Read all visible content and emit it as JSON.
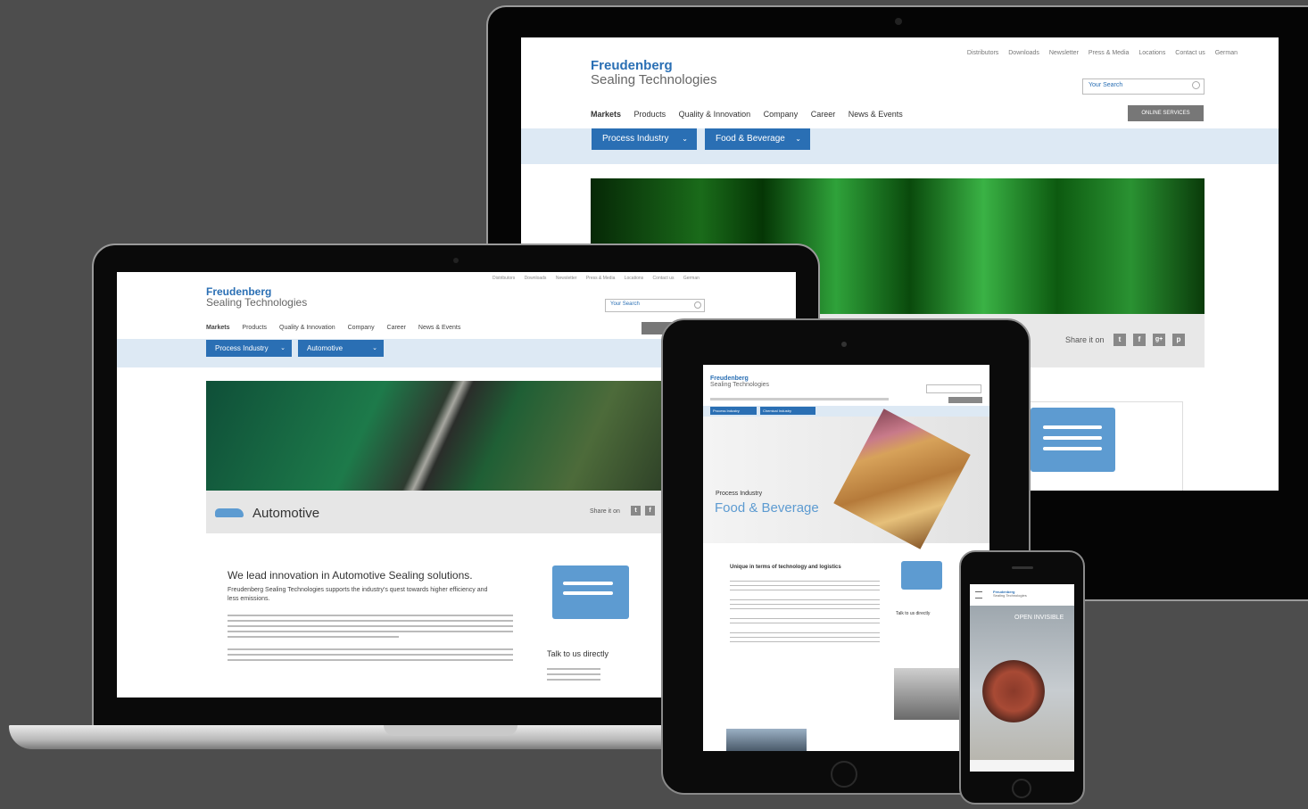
{
  "brand": {
    "name": "Freudenberg",
    "sub": "Sealing Technologies"
  },
  "top_nav": [
    "Distributors",
    "Downloads",
    "Newsletter",
    "Press & Media",
    "Locations",
    "Contact us",
    "German"
  ],
  "search_placeholder": "Your Search",
  "main_nav": [
    "Markets",
    "Products",
    "Quality & Innovation",
    "Company",
    "Career",
    "News & Events"
  ],
  "online_services": "ONLINE SERVICES",
  "share_label": "Share it on",
  "share_icons": [
    "t",
    "f",
    "g+",
    "p"
  ],
  "desktop": {
    "breadcrumb_buttons": [
      "Process Industry",
      "Food & Beverage"
    ]
  },
  "laptop": {
    "breadcrumb_buttons": [
      "Process Industry",
      "Automotive"
    ],
    "hero_title": "Automotive",
    "headline": "We lead innovation in Automotive Sealing solutions.",
    "subhead": "Freudenberg Sealing Technologies supports the industry's quest towards higher efficiency and less emissions.",
    "contact_cta": "Talk to us directly"
  },
  "tablet": {
    "breadcrumb_buttons": [
      "Process Industry",
      "Chemical Industry"
    ],
    "kicker": "Process Industry",
    "hero_title": "Food & Beverage",
    "section_title": "Unique in terms of technology and logistics",
    "contact_cta": "Talk to us directly"
  },
  "phone": {
    "hero_text": "OPEN INVISIBLE"
  }
}
